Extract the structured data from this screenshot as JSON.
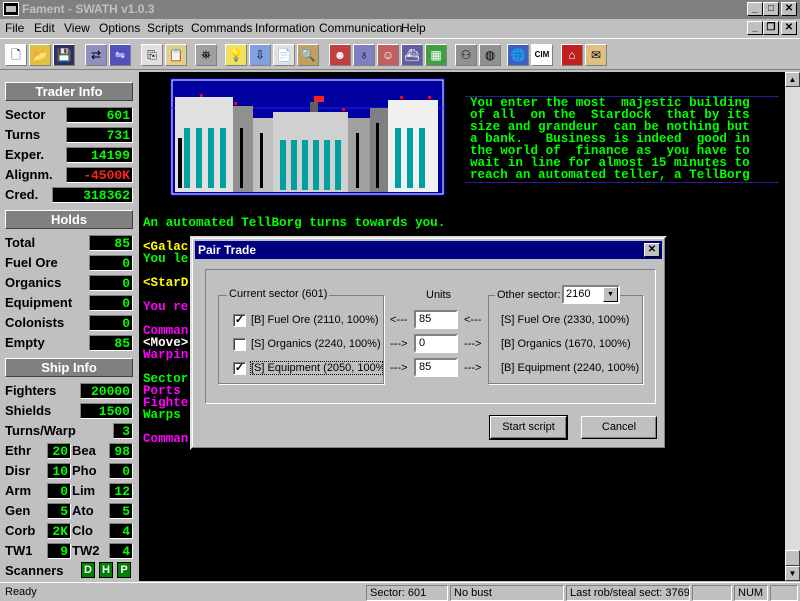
{
  "window": {
    "title": "Fament - SWATH v1.0.3"
  },
  "menu": [
    "File",
    "Edit",
    "View",
    "Options",
    "Scripts",
    "Commands",
    "Information",
    "Communication",
    "Help"
  ],
  "trader_info": {
    "header": "Trader Info",
    "rows": [
      {
        "label": "Sector",
        "value": "601"
      },
      {
        "label": "Turns",
        "value": "731"
      },
      {
        "label": "Exper.",
        "value": "14199"
      },
      {
        "label": "Alignm.",
        "value": "-4500K"
      },
      {
        "label": "Cred.",
        "value": "318362"
      }
    ]
  },
  "holds": {
    "header": "Holds",
    "rows": [
      {
        "label": "Total",
        "value": "85"
      },
      {
        "label": "Fuel Ore",
        "value": "0"
      },
      {
        "label": "Organics",
        "value": "0"
      },
      {
        "label": "Equipment",
        "value": "0"
      },
      {
        "label": "Colonists",
        "value": "0"
      },
      {
        "label": "Empty",
        "value": "85"
      }
    ]
  },
  "ship_info": {
    "header": "Ship Info",
    "rows": [
      {
        "label": "Fighters",
        "value": "20000"
      },
      {
        "label": "Shields",
        "value": "1500"
      },
      {
        "label": "Turns/Warp",
        "value": "3"
      }
    ],
    "pairs": [
      {
        "l1": "Ethr",
        "v1": "20",
        "l2": "Bea",
        "v2": "98"
      },
      {
        "l1": "Disr",
        "v1": "10",
        "l2": "Pho",
        "v2": "0"
      },
      {
        "l1": "Arm",
        "v1": "0",
        "l2": "Lim",
        "v2": "12"
      },
      {
        "l1": "Gen",
        "v1": "5",
        "l2": "Ato",
        "v2": "5"
      },
      {
        "l1": "Corb",
        "v1": "2K",
        "l2": "Clo",
        "v2": "4"
      },
      {
        "l1": "TW1",
        "v1": "9",
        "l2": "TW2",
        "v2": "4"
      }
    ],
    "scanners": {
      "label": "Scanners",
      "buttons": [
        "D",
        "H",
        "P"
      ]
    }
  },
  "terminal": {
    "description": [
      "You enter the most  majestic building",
      "of all  on the  Stardock  that by its",
      "size and grandeur  can be nothing but",
      "a bank.   Business is indeed  good in",
      "the world of  finance as  you have to",
      "wait in line for almost 15 minutes to",
      "reach an automated teller, a TellBorg"
    ],
    "lines": [
      {
        "text": "An automated TellBorg turns towards you.",
        "color": "#00ff00"
      },
      {
        "text": "<Galac",
        "color": "#ffff00"
      },
      {
        "text": "You le",
        "color": "#00ff00"
      },
      {
        "text": "<StarD",
        "color": "#ffff00"
      },
      {
        "text": "You re",
        "color": "#ff00ff"
      },
      {
        "text": "Comman",
        "color": "#ff00ff"
      },
      {
        "text": "<Move>",
        "color": "#ffffff"
      },
      {
        "text": "Warpin",
        "color": "#ff00ff"
      },
      {
        "text": "Sector",
        "color": "#00ff00"
      },
      {
        "text": "Ports",
        "color": "#ff00ff"
      },
      {
        "text": "Fighte",
        "color": "#ff00ff"
      },
      {
        "text": "Warps",
        "color": "#00ff00"
      },
      {
        "text": "Comman",
        "color": "#ff00ff"
      }
    ]
  },
  "dialog": {
    "title": "Pair Trade",
    "current_sector_label": "Current sector (601)",
    "units_label": "Units",
    "other_sector_label": "Other sector:",
    "other_sector_value": "2160",
    "rows": [
      {
        "checked": true,
        "left": "[B] Fuel Ore  (2110, 100%)",
        "arrow1": "<---",
        "units": "85",
        "arrow2": "<---",
        "right": "[S] Fuel Ore  (2330, 100%)"
      },
      {
        "checked": false,
        "left": "[S] Organics  (2240, 100%)",
        "arrow1": "--->",
        "units": "0",
        "arrow2": "--->",
        "right": "[B] Organics  (1670, 100%)"
      },
      {
        "checked": true,
        "left": "[S] Equipment  (2050, 100%)",
        "arrow1": "--->",
        "units": "85",
        "arrow2": "--->",
        "right": "[B] Equipment  (2240, 100%)"
      }
    ],
    "start_button": "Start script",
    "cancel_button": "Cancel"
  },
  "statusbar": {
    "ready": "Ready",
    "sector": "Sector: 601",
    "bust": "No bust",
    "last_rob": "Last rob/steal sect: 3769",
    "num": "NUM"
  }
}
